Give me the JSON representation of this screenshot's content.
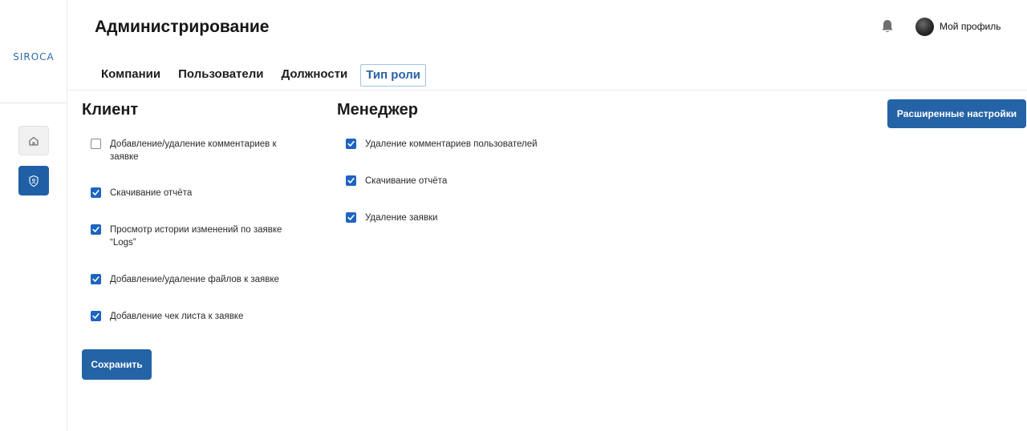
{
  "app": {
    "logo_text": "SIROCA",
    "page_title": "Администрирование",
    "profile_label": "Мой профиль"
  },
  "sidebar": {
    "items": [
      {
        "icon": "home-icon"
      },
      {
        "icon": "shield-role-icon",
        "active": true
      }
    ]
  },
  "tabs": [
    {
      "label": "Компании",
      "active": false
    },
    {
      "label": "Пользователи",
      "active": false
    },
    {
      "label": "Должности",
      "active": false
    },
    {
      "label": "Тип роли",
      "active": true
    }
  ],
  "client": {
    "title": "Клиент",
    "permissions": [
      {
        "label": "Добавление/удаление комментариев к заявке",
        "checked": false
      },
      {
        "label": "Скачивание отчёта",
        "checked": true
      },
      {
        "label": "Просмотр истории изменений по заявке “Logs”",
        "checked": true
      },
      {
        "label": "Добавление/удаление файлов к заявке",
        "checked": true
      },
      {
        "label": "Добавление чек листа к заявке",
        "checked": true
      }
    ]
  },
  "manager": {
    "title": "Менеджер",
    "permissions": [
      {
        "label": "Удаление комментариев пользователей",
        "checked": true
      },
      {
        "label": "Скачивание отчёта",
        "checked": true
      },
      {
        "label": "Удаление заявки",
        "checked": true
      }
    ]
  },
  "buttons": {
    "save_label": "Сохранить",
    "advanced_label": "Расширенные настройки"
  },
  "colors": {
    "accent": "#2463a6",
    "checkbox": "#1e64c0"
  }
}
